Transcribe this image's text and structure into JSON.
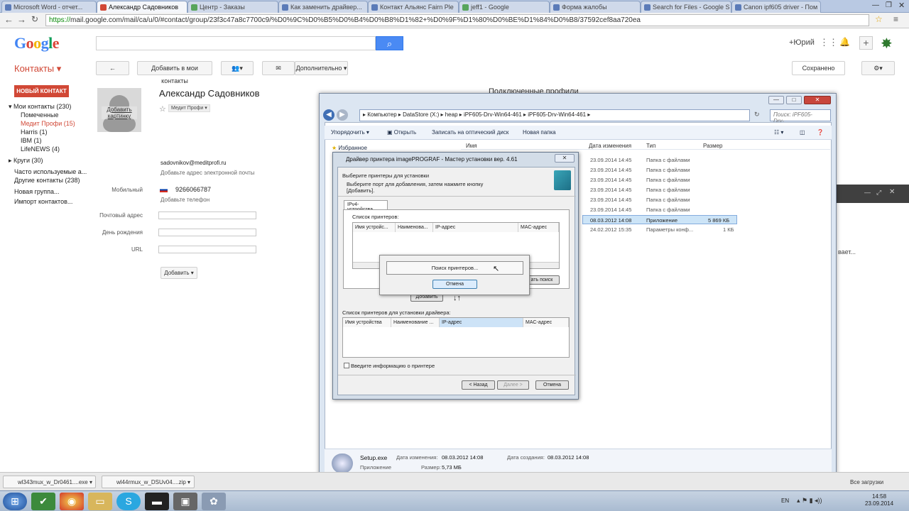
{
  "browser": {
    "tabs": [
      "Microsoft Word - отчет...",
      "Александр Садовников",
      "Центр - Заказы",
      "Как заменить драйвер...",
      "Контакт Альянс Fairn Ple",
      "jeff1 - Google",
      "Форма жалобы",
      "Search for Files - Google S",
      "Canon ipf605 driver - Пом"
    ],
    "url_scheme": "https://",
    "url_rest": "mail.google.com/mail/ca/u/0/#contact/group/23f3c47a8c7700c9/%D0%9C%D0%B5%D0%B4%D0%B8%D1%82+%D0%9F%D1%80%D0%BE%D1%84%D0%B8/37592cef8aa720ea"
  },
  "gmail": {
    "logo": "Google",
    "user": "+Юрий",
    "contacts_title": "Контакты ▾",
    "btn_back": "←",
    "btn_add_to_contacts": "Добавить в мои контакты",
    "btn_more": "Дополнительно ▾",
    "saved": "Сохранено",
    "new_contact": "НОВЫЙ КОНТАКТ",
    "sidebar": [
      "Мои контакты (230)",
      "Помеченные",
      "Медит Профи (15)",
      "Harris (1)",
      "IBM (1)",
      "LifeNEWS (4)",
      "Круги (30)",
      "Часто используемые а...",
      "Другие контакты (238)",
      "Новая группа...",
      "Импорт контактов..."
    ],
    "photo_label": "Добавить картинку",
    "contact_name": "Александр Садовников",
    "group_tag": "Медит Профи",
    "email": "sadovnikov@meditprofi.ru",
    "add_email": "Добавьте адрес электронной почты",
    "mobile_label": "Мобильный",
    "phone": "9266066787",
    "add_phone": "Добавьте телефон",
    "address_label": "Почтовый адрес",
    "birthday_label": "День рождения",
    "url_label": "URL",
    "add_btn": "Добавить ▾",
    "connected_profiles": "Подключенные профили",
    "right_fragment": "вает..."
  },
  "explorer": {
    "path": [
      "Компьютер",
      "DataStore (X:)",
      "heap",
      "iPF605-Drv-Win64-461",
      "iPF605-Drv-Win64-461"
    ],
    "search_placeholder": "Поиск: iPF605-Drv-...",
    "toolbar": [
      "Упорядочить ▾",
      "Открыть",
      "Записать на оптический диск",
      "Новая папка"
    ],
    "favorites": "Избранное",
    "columns": [
      "Имя",
      "Дата изменения",
      "Тип",
      "Размер"
    ],
    "rows": [
      {
        "date": "23.09.2014 14:45",
        "type": "Папка с файлами",
        "size": ""
      },
      {
        "date": "23.09.2014 14:45",
        "type": "Папка с файлами",
        "size": ""
      },
      {
        "date": "23.09.2014 14:45",
        "type": "Папка с файлами",
        "size": ""
      },
      {
        "date": "23.09.2014 14:45",
        "type": "Папка с файлами",
        "size": ""
      },
      {
        "date": "23.09.2014 14:45",
        "type": "Папка с файлами",
        "size": ""
      },
      {
        "date": "23.09.2014 14:45",
        "type": "Папка с файлами",
        "size": ""
      },
      {
        "date": "08.03.2012 14:08",
        "type": "Приложение",
        "size": "5 869 КБ"
      },
      {
        "date": "24.02.2012 15:35",
        "type": "Параметры конф...",
        "size": "1 КБ"
      }
    ],
    "status_name": "Setup.exe",
    "status_kind": "Приложение",
    "status_modified_label": "Дата изменения:",
    "status_modified": "08.03.2012 14:08",
    "status_created_label": "Дата создания:",
    "status_created": "08.03.2012 14:08",
    "status_size_label": "Размер:",
    "status_size": "5,73 МБ"
  },
  "dialog": {
    "title": "Драйвер принтера imagePROGRAF - Мастер установки вер. 4.61",
    "heading": "Выберите принтеры для установки",
    "subtext1": "Выберите порт для добавления, затем нажмите кнопку",
    "subtext2": "[Добавить].",
    "tab": "IPv4-устройства",
    "printer_list": "Список принтеров:",
    "cols1": [
      "Имя устройс...",
      "Наименова...",
      "IP-адрес",
      "MAC-адрес"
    ],
    "install_list": "Список принтеров для установки драйвера:",
    "cols2": [
      "Имя устройства",
      "Наименование ...",
      "IP-адрес",
      "MAC-адрес"
    ],
    "checkbox": "Введите информацию о принтере",
    "btn_back": "< Назад",
    "btn_next": "Далее >",
    "btn_cancel": "Отмена",
    "btn_add": "Добавить",
    "btn_search_partial": "ать поиск",
    "popup_text": "Поиск принтеров...",
    "popup_cancel": "Отмена"
  },
  "downloads": [
    "wl343mux_w_Dr0461....exe",
    "wl44rmux_w_DSUv04....zip"
  ],
  "taskbar": {
    "lang": "EN",
    "time": "14:58",
    "date": "23.09.2014",
    "status_fragment": "Все загрузки"
  }
}
